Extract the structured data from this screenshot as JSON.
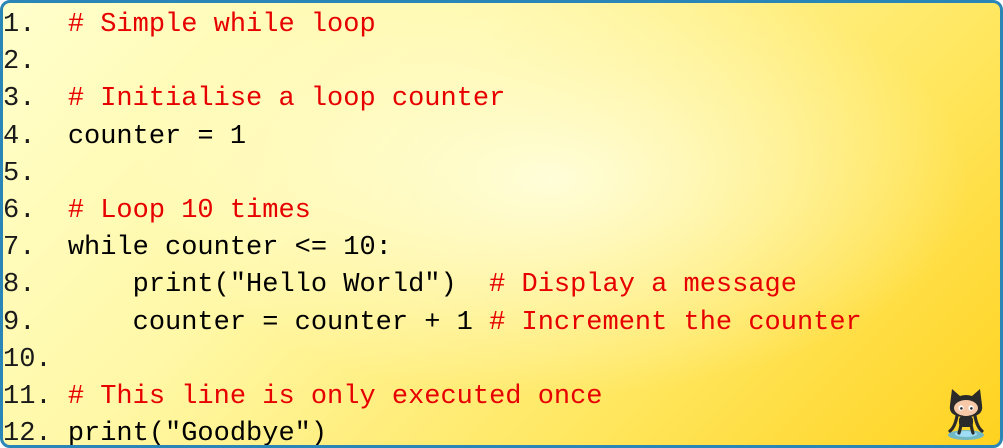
{
  "code": {
    "lines": [
      {
        "num": "1.",
        "pad": "  ",
        "code": "",
        "comment": "# Simple while loop"
      },
      {
        "num": "2.",
        "pad": "",
        "code": "",
        "comment": ""
      },
      {
        "num": "3.",
        "pad": "  ",
        "code": "",
        "comment": "# Initialise a loop counter"
      },
      {
        "num": "4.",
        "pad": "  ",
        "code": "counter = 1",
        "comment": ""
      },
      {
        "num": "5.",
        "pad": "",
        "code": "",
        "comment": ""
      },
      {
        "num": "6.",
        "pad": "  ",
        "code": "",
        "comment": "# Loop 10 times"
      },
      {
        "num": "7.",
        "pad": "  ",
        "code": "while counter <= 10:",
        "comment": ""
      },
      {
        "num": "8.",
        "pad": "  ",
        "code": "    print(\"Hello World\")  ",
        "comment": "# Display a message"
      },
      {
        "num": "9.",
        "pad": "  ",
        "code": "    counter = counter + 1 ",
        "comment": "# Increment the counter"
      },
      {
        "num": "10.",
        "pad": "",
        "code": "",
        "comment": ""
      },
      {
        "num": "11.",
        "pad": " ",
        "code": "",
        "comment": "# This line is only executed once"
      },
      {
        "num": "12.",
        "pad": " ",
        "code": "print(\"Goodbye\")",
        "comment": ""
      }
    ]
  },
  "colors": {
    "comment": "#e60000",
    "code": "#000000",
    "border": "#2b86b8",
    "background_light": "#ffffcc",
    "background_dark": "#ffd21f"
  },
  "icons": {
    "logo": "octocat-icon"
  }
}
